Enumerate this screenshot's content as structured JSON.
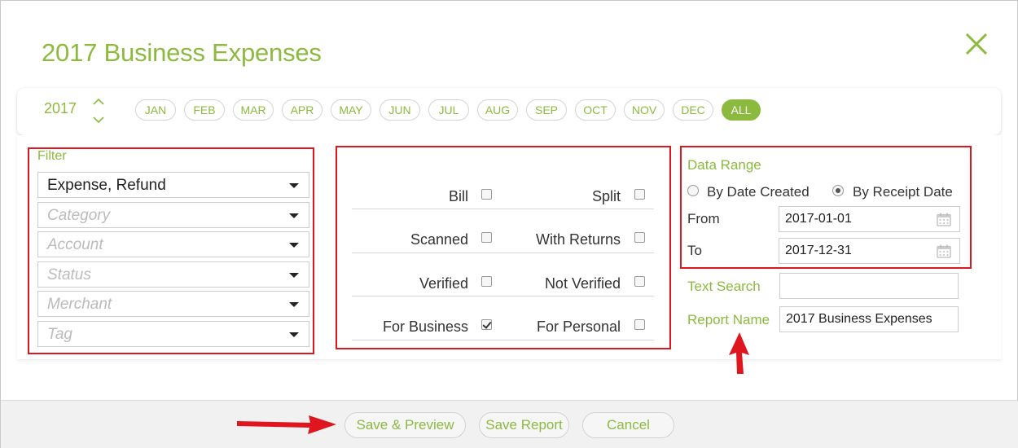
{
  "dialog": {
    "title": "2017 Business Expenses"
  },
  "period": {
    "year": "2017",
    "months": [
      "JAN",
      "FEB",
      "MAR",
      "APR",
      "MAY",
      "JUN",
      "JUL",
      "AUG",
      "SEP",
      "OCT",
      "NOV",
      "DEC",
      "ALL"
    ],
    "selected": "ALL"
  },
  "filter": {
    "label": "Filter",
    "type_value": "Expense, Refund",
    "category_placeholder": "Category",
    "account_placeholder": "Account",
    "status_placeholder": "Status",
    "merchant_placeholder": "Merchant",
    "tag_placeholder": "Tag"
  },
  "flags": {
    "bill": {
      "label": "Bill",
      "checked": false
    },
    "split": {
      "label": "Split",
      "checked": false
    },
    "scanned": {
      "label": "Scanned",
      "checked": false
    },
    "with_returns": {
      "label": "With Returns",
      "checked": false
    },
    "verified": {
      "label": "Verified",
      "checked": false
    },
    "not_verified": {
      "label": "Not Verified",
      "checked": false
    },
    "for_business": {
      "label": "For Business",
      "checked": true
    },
    "for_personal": {
      "label": "For Personal",
      "checked": false
    }
  },
  "date_range": {
    "label": "Data Range",
    "by_created_label": "By Date Created",
    "by_receipt_label": "By Receipt Date",
    "selected": "By Receipt Date",
    "from_label": "From",
    "from_value": "2017-01-01",
    "to_label": "To",
    "to_value": "2017-12-31"
  },
  "text_search": {
    "label": "Text Search",
    "value": ""
  },
  "report_name": {
    "label": "Report Name",
    "value": "2017 Business Expenses"
  },
  "footer": {
    "save_preview": "Save & Preview",
    "save_report": "Save Report",
    "cancel": "Cancel"
  },
  "colors": {
    "accent": "#8cba3f",
    "annotation": "#e0161e"
  },
  "icons": [
    "close-icon",
    "chevron-up-icon",
    "chevron-down-icon",
    "caret-down-icon",
    "calendar-icon",
    "checkmark-icon",
    "arrow-annotation"
  ]
}
